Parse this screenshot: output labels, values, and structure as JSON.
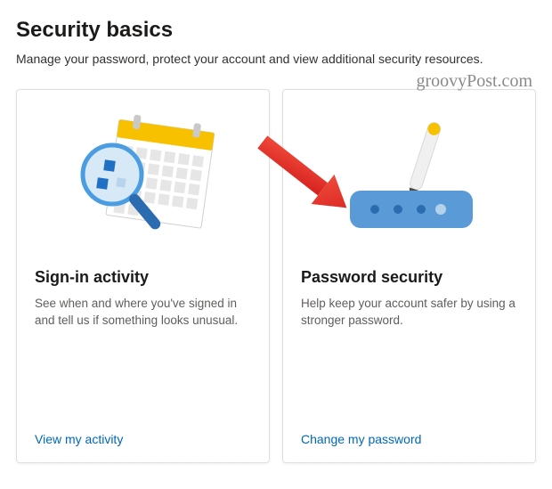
{
  "header": {
    "title": "Security basics",
    "subtitle": "Manage your password, protect your account and view additional security resources."
  },
  "watermark": "groovyPost.com",
  "cards": [
    {
      "title": "Sign-in activity",
      "description": "See when and where you've signed in and tell us if something looks unusual.",
      "link_text": "View my activity"
    },
    {
      "title": "Password security",
      "description": "Help keep your account safer by using a stronger password.",
      "link_text": "Change my password"
    }
  ]
}
